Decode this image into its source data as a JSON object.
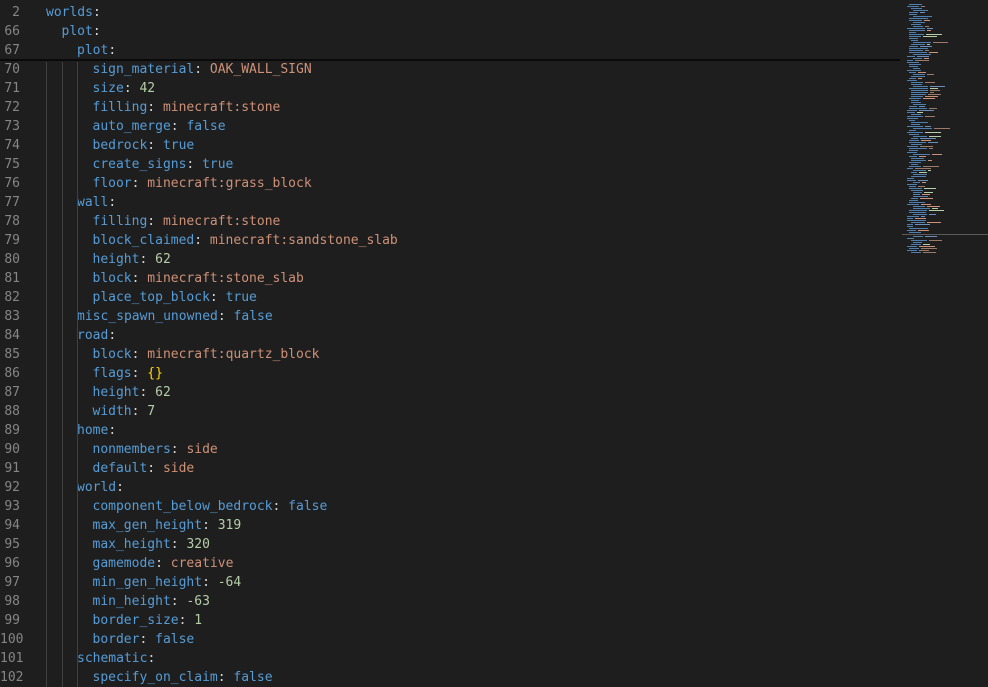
{
  "editor": {
    "colors": {
      "background": "#1e1e1e",
      "line_number": "#858585",
      "key": "#569cd6",
      "punctuation": "#d4d4d4",
      "string": "#ce9178",
      "number": "#b5cea8",
      "boolean": "#569cd6",
      "bracket": "#ffd700"
    },
    "sticky_lines": [
      {
        "num": "2",
        "indent": 0,
        "key": "worlds",
        "value": "",
        "type": "none"
      },
      {
        "num": "66",
        "indent": 1,
        "key": "plot",
        "value": "",
        "type": "none"
      },
      {
        "num": "67",
        "indent": 2,
        "key": "plot",
        "value": "",
        "type": "none"
      }
    ],
    "lines": [
      {
        "num": "70",
        "indent": 3,
        "key": "sign_material",
        "value": "OAK_WALL_SIGN",
        "type": "string"
      },
      {
        "num": "71",
        "indent": 3,
        "key": "size",
        "value": "42",
        "type": "number"
      },
      {
        "num": "72",
        "indent": 3,
        "key": "filling",
        "value": "minecraft:stone",
        "type": "string"
      },
      {
        "num": "73",
        "indent": 3,
        "key": "auto_merge",
        "value": "false",
        "type": "boolean"
      },
      {
        "num": "74",
        "indent": 3,
        "key": "bedrock",
        "value": "true",
        "type": "boolean"
      },
      {
        "num": "75",
        "indent": 3,
        "key": "create_signs",
        "value": "true",
        "type": "boolean"
      },
      {
        "num": "76",
        "indent": 3,
        "key": "floor",
        "value": "minecraft:grass_block",
        "type": "string"
      },
      {
        "num": "77",
        "indent": 2,
        "key": "wall",
        "value": "",
        "type": "none"
      },
      {
        "num": "78",
        "indent": 3,
        "key": "filling",
        "value": "minecraft:stone",
        "type": "string"
      },
      {
        "num": "79",
        "indent": 3,
        "key": "block_claimed",
        "value": "minecraft:sandstone_slab",
        "type": "string"
      },
      {
        "num": "80",
        "indent": 3,
        "key": "height",
        "value": "62",
        "type": "number"
      },
      {
        "num": "81",
        "indent": 3,
        "key": "block",
        "value": "minecraft:stone_slab",
        "type": "string"
      },
      {
        "num": "82",
        "indent": 3,
        "key": "place_top_block",
        "value": "true",
        "type": "boolean"
      },
      {
        "num": "83",
        "indent": 2,
        "key": "misc_spawn_unowned",
        "value": "false",
        "type": "boolean"
      },
      {
        "num": "84",
        "indent": 2,
        "key": "road",
        "value": "",
        "type": "none"
      },
      {
        "num": "85",
        "indent": 3,
        "key": "block",
        "value": "minecraft:quartz_block",
        "type": "string"
      },
      {
        "num": "86",
        "indent": 3,
        "key": "flags",
        "value": "{}",
        "type": "bracket"
      },
      {
        "num": "87",
        "indent": 3,
        "key": "height",
        "value": "62",
        "type": "number"
      },
      {
        "num": "88",
        "indent": 3,
        "key": "width",
        "value": "7",
        "type": "number"
      },
      {
        "num": "89",
        "indent": 2,
        "key": "home",
        "value": "",
        "type": "none"
      },
      {
        "num": "90",
        "indent": 3,
        "key": "nonmembers",
        "value": "side",
        "type": "string"
      },
      {
        "num": "91",
        "indent": 3,
        "key": "default",
        "value": "side",
        "type": "string"
      },
      {
        "num": "92",
        "indent": 2,
        "key": "world",
        "value": "",
        "type": "none"
      },
      {
        "num": "93",
        "indent": 3,
        "key": "component_below_bedrock",
        "value": "false",
        "type": "boolean"
      },
      {
        "num": "94",
        "indent": 3,
        "key": "max_gen_height",
        "value": "319",
        "type": "number"
      },
      {
        "num": "95",
        "indent": 3,
        "key": "max_height",
        "value": "320",
        "type": "number"
      },
      {
        "num": "96",
        "indent": 3,
        "key": "gamemode",
        "value": "creative",
        "type": "string"
      },
      {
        "num": "97",
        "indent": 3,
        "key": "min_gen_height",
        "value": "-64",
        "type": "number"
      },
      {
        "num": "98",
        "indent": 3,
        "key": "min_height",
        "value": "-63",
        "type": "number"
      },
      {
        "num": "99",
        "indent": 3,
        "key": "border_size",
        "value": "1",
        "type": "number"
      },
      {
        "num": "100",
        "indent": 3,
        "key": "border",
        "value": "false",
        "type": "boolean"
      },
      {
        "num": "101",
        "indent": 2,
        "key": "schematic",
        "value": "",
        "type": "none"
      },
      {
        "num": "102",
        "indent": 3,
        "key": "specify_on_claim",
        "value": "false",
        "type": "boolean"
      }
    ]
  }
}
